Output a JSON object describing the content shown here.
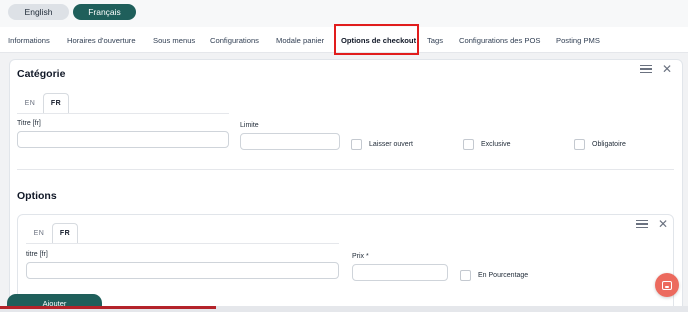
{
  "language_switch": {
    "english": "English",
    "french": "Français"
  },
  "tabs": [
    {
      "label": "Informations"
    },
    {
      "label": "Horaires d'ouverture"
    },
    {
      "label": "Sous menus"
    },
    {
      "label": "Configurations"
    },
    {
      "label": "Modale panier"
    },
    {
      "label": "Options de checkout",
      "active": true
    },
    {
      "label": "Tags"
    },
    {
      "label": "Configurations des POS"
    },
    {
      "label": "Posting PMS"
    }
  ],
  "category": {
    "title": "Catégorie",
    "lang_tabs": [
      "EN",
      "FR"
    ],
    "active_lang": "FR",
    "title_label": "Titre [fr]",
    "title_value": "",
    "limit_label": "Limite",
    "limit_value": "",
    "checkboxes": [
      {
        "label": "Laisser ouvert",
        "checked": false
      },
      {
        "label": "Exclusive",
        "checked": false
      },
      {
        "label": "Obligatoire",
        "checked": false
      }
    ]
  },
  "options": {
    "title": "Options",
    "lang_tabs": [
      "EN",
      "FR"
    ],
    "active_lang": "FR",
    "title_label": "titre [fr]",
    "title_value": "",
    "price_label": "Prix *",
    "price_value": "",
    "percentage_label": "En Pourcentage",
    "percentage_checked": false,
    "add_button": "Ajouter"
  },
  "colors": {
    "brand": "#1f5f5b",
    "highlight": "#e11d1d",
    "chat": "#ec6a5e"
  },
  "icons": [
    "menu-icon",
    "close-icon",
    "chat-icon"
  ]
}
